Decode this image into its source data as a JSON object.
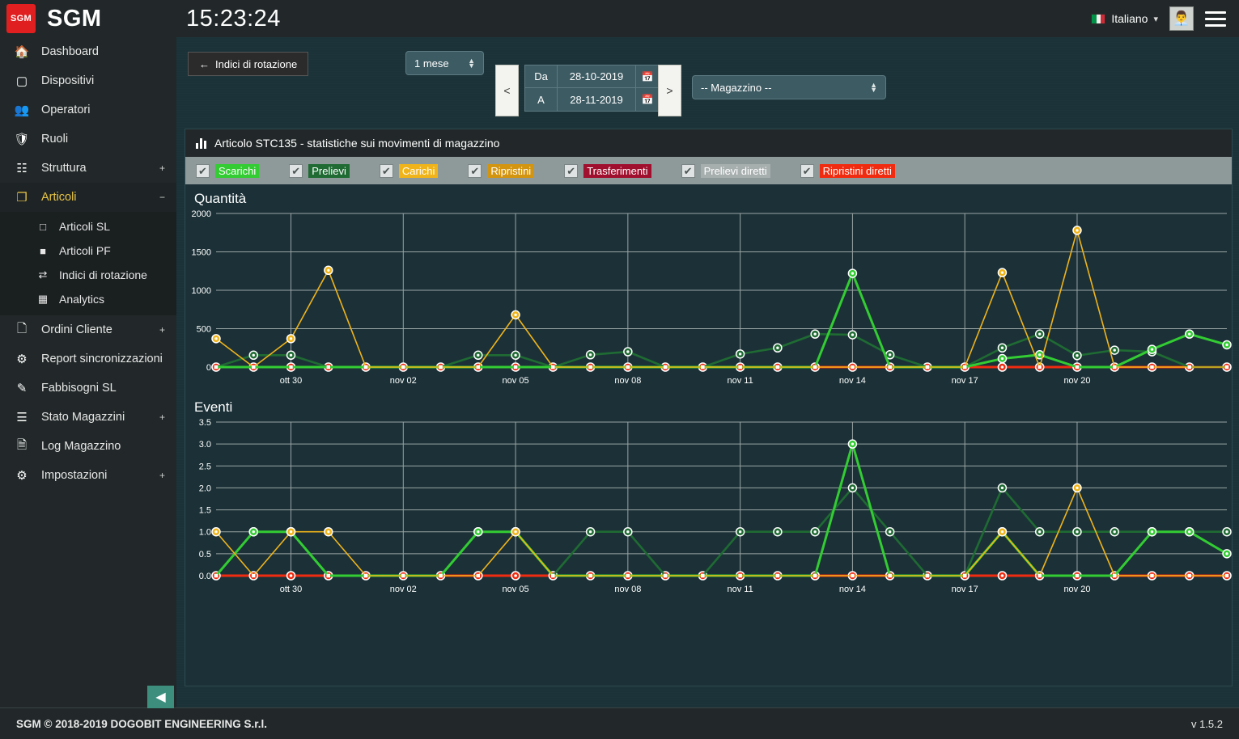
{
  "topbar": {
    "logo_text": "SGM",
    "brand": "SGM",
    "clock": "15:23:24",
    "language": "Italiano",
    "caret_icon": "chevron-down-icon",
    "avatar_icon": "user-avatar",
    "menu_icon": "hamburger-icon"
  },
  "sidebar": {
    "items": [
      {
        "label": "Dashboard",
        "icon": "home-icon",
        "expand": null,
        "active": false
      },
      {
        "label": "Dispositivi",
        "icon": "tablet-icon",
        "expand": null,
        "active": false
      },
      {
        "label": "Operatori",
        "icon": "users-icon",
        "expand": null,
        "active": false
      },
      {
        "label": "Ruoli",
        "icon": "shield-icon",
        "expand": null,
        "active": false
      },
      {
        "label": "Struttura",
        "icon": "sitemap-icon",
        "expand": "+",
        "active": false
      },
      {
        "label": "Articoli",
        "icon": "copy-icon",
        "expand": "−",
        "active": true
      }
    ],
    "sub_items": [
      {
        "label": "Articoli SL",
        "icon": "square-outline-icon"
      },
      {
        "label": "Articoli PF",
        "icon": "square-filled-icon"
      },
      {
        "label": "Indici di rotazione",
        "icon": "exchange-icon"
      },
      {
        "label": "Analytics",
        "icon": "table-icon"
      }
    ],
    "items_after": [
      {
        "label": "Ordini Cliente",
        "icon": "files-icon",
        "expand": "+"
      },
      {
        "label": "Report sincronizzazioni",
        "icon": "cogs-icon",
        "expand": null
      },
      {
        "label": "Fabbisogni SL",
        "icon": "edit-icon",
        "expand": null
      },
      {
        "label": "Stato Magazzini",
        "icon": "server-icon",
        "expand": "+"
      },
      {
        "label": "Log Magazzino",
        "icon": "file-text-icon",
        "expand": null
      },
      {
        "label": "Impostazioni",
        "icon": "gear-icon",
        "expand": "+"
      }
    ],
    "collapse_icon": "collapse-left-icon"
  },
  "toolbar": {
    "back_label": "Indici di rotazione",
    "back_icon": "arrow-left-icon",
    "period_value": "1 mese",
    "prev_label": "<",
    "next_label": ">",
    "from_label": "Da",
    "from_value": "28-10-2019",
    "to_label": "A",
    "to_value": "28-11-2019",
    "calendar_icon": "calendar-icon",
    "warehouse_value": "-- Magazzino --"
  },
  "panel": {
    "title": "Articolo STC135 - statistiche sui movimenti di magazzino",
    "title_icon": "bar-chart-icon",
    "legend": [
      {
        "label": "Scarichi",
        "bg": "#33cc33",
        "fg": "#ffffff",
        "checked": true
      },
      {
        "label": "Prelievi",
        "bg": "#1f6b33",
        "fg": "#ffffff",
        "checked": true
      },
      {
        "label": "Carichi",
        "bg": "#f0b41a",
        "fg": "#ffffff",
        "checked": true
      },
      {
        "label": "Ripristini",
        "bg": "#d39410",
        "fg": "#ffffff",
        "checked": true
      },
      {
        "label": "Trasferimenti",
        "bg": "#a00f2e",
        "fg": "#ffffff",
        "checked": true
      },
      {
        "label": "Prelievi diretti",
        "bg": "#a7aeae",
        "fg": "#ffffff",
        "checked": true
      },
      {
        "label": "Ripristini diretti",
        "bg": "#f02b10",
        "fg": "#ffffff",
        "checked": true
      }
    ]
  },
  "chart_data": [
    {
      "type": "line",
      "title": "Quantità",
      "xlabel": "",
      "ylabel": "",
      "ylim": [
        0,
        2000
      ],
      "yticks": [
        0,
        500,
        1000,
        1500,
        2000
      ],
      "ytick_labels": [
        "0",
        "500",
        "1000",
        "1500",
        "2000"
      ],
      "grid": true,
      "legend_position": "top",
      "x": [
        "ott 28",
        "ott 29",
        "ott 30",
        "ott 31",
        "nov 01",
        "nov 02",
        "nov 03",
        "nov 04",
        "nov 05",
        "nov 06",
        "nov 07",
        "nov 08",
        "nov 09",
        "nov 10",
        "nov 11",
        "nov 12",
        "nov 13",
        "nov 14",
        "nov 15",
        "nov 16",
        "nov 17",
        "nov 18",
        "nov 19",
        "nov 20",
        "nov 21",
        "nov 22",
        "nov 23",
        "nov 24"
      ],
      "xtick_labels": [
        "ott 30",
        "nov 02",
        "nov 05",
        "nov 08",
        "nov 11",
        "nov 14",
        "nov 17",
        "nov 20"
      ],
      "xtick_indices": [
        2,
        5,
        8,
        11,
        14,
        17,
        20,
        23
      ],
      "series": [
        {
          "name": "Scarichi",
          "color": "#33cc33",
          "values": [
            0,
            0,
            0,
            0,
            0,
            0,
            0,
            0,
            0,
            0,
            0,
            0,
            0,
            0,
            0,
            0,
            0,
            1220,
            0,
            0,
            0,
            110,
            160,
            0,
            0,
            230,
            430,
            290
          ]
        },
        {
          "name": "Prelievi",
          "color": "#1f6b33",
          "values": [
            0,
            155,
            155,
            0,
            0,
            0,
            0,
            155,
            155,
            0,
            160,
            200,
            0,
            0,
            170,
            250,
            430,
            420,
            160,
            0,
            0,
            250,
            430,
            150,
            220,
            200,
            0,
            0
          ]
        },
        {
          "name": "Carichi",
          "color": "#f0b41a",
          "values": [
            370,
            0,
            370,
            1260,
            0,
            0,
            0,
            0,
            680,
            0,
            0,
            0,
            0,
            0,
            0,
            0,
            0,
            0,
            0,
            0,
            0,
            1230,
            0,
            1780,
            0,
            0,
            0,
            0
          ]
        },
        {
          "name": "Ripristini",
          "color": "#d39410",
          "values": [
            0,
            0,
            0,
            0,
            0,
            0,
            0,
            0,
            0,
            0,
            0,
            0,
            0,
            0,
            0,
            0,
            0,
            0,
            0,
            0,
            0,
            0,
            0,
            0,
            0,
            0,
            0,
            0
          ]
        },
        {
          "name": "Trasferimenti",
          "color": "#a00f2e",
          "values": [
            0,
            0,
            0,
            0,
            0,
            0,
            0,
            0,
            0,
            0,
            0,
            0,
            0,
            0,
            0,
            0,
            0,
            0,
            0,
            0,
            0,
            0,
            0,
            0,
            0,
            0,
            0,
            0
          ]
        },
        {
          "name": "Prelievi diretti",
          "color": "#a7aeae",
          "values": [
            0,
            0,
            0,
            0,
            0,
            0,
            0,
            0,
            0,
            0,
            0,
            0,
            0,
            0,
            0,
            0,
            0,
            0,
            0,
            0,
            0,
            0,
            0,
            0,
            0,
            0,
            0,
            0
          ]
        },
        {
          "name": "Ripristini diretti",
          "color": "#f02b10",
          "values": [
            0,
            0,
            0,
            0,
            0,
            0,
            0,
            0,
            0,
            0,
            0,
            0,
            0,
            0,
            0,
            0,
            0,
            0,
            0,
            0,
            0,
            0,
            0,
            0,
            0,
            0,
            0,
            0
          ]
        }
      ]
    },
    {
      "type": "line",
      "title": "Eventi",
      "xlabel": "",
      "ylabel": "",
      "ylim": [
        0,
        3.5
      ],
      "yticks": [
        0.0,
        0.5,
        1.0,
        1.5,
        2.0,
        2.5,
        3.0,
        3.5
      ],
      "ytick_labels": [
        "0.0",
        "0.5",
        "1.0",
        "1.5",
        "2.0",
        "2.5",
        "3.0",
        "3.5"
      ],
      "grid": true,
      "legend_position": "top",
      "x": [
        "ott 28",
        "ott 29",
        "ott 30",
        "ott 31",
        "nov 01",
        "nov 02",
        "nov 03",
        "nov 04",
        "nov 05",
        "nov 06",
        "nov 07",
        "nov 08",
        "nov 09",
        "nov 10",
        "nov 11",
        "nov 12",
        "nov 13",
        "nov 14",
        "nov 15",
        "nov 16",
        "nov 17",
        "nov 18",
        "nov 19",
        "nov 20",
        "nov 21",
        "nov 22",
        "nov 23",
        "nov 24"
      ],
      "xtick_labels": [
        "ott 30",
        "nov 02",
        "nov 05",
        "nov 08",
        "nov 11",
        "nov 14",
        "nov 17",
        "nov 20"
      ],
      "xtick_indices": [
        2,
        5,
        8,
        11,
        14,
        17,
        20,
        23
      ],
      "series": [
        {
          "name": "Scarichi",
          "color": "#33cc33",
          "values": [
            0,
            1,
            1,
            0,
            0,
            0,
            0,
            1,
            1,
            0,
            0,
            0,
            0,
            0,
            0,
            0,
            0,
            3,
            0,
            0,
            0,
            1,
            0,
            0,
            0,
            1,
            1,
            0.5
          ]
        },
        {
          "name": "Prelievi",
          "color": "#1f6b33",
          "values": [
            0,
            1,
            1,
            0,
            0,
            0,
            0,
            1,
            1,
            0,
            1,
            1,
            0,
            0,
            1,
            1,
            1,
            2,
            1,
            0,
            0,
            2,
            1,
            1,
            1,
            1,
            1,
            1
          ]
        },
        {
          "name": "Carichi",
          "color": "#f0b41a",
          "values": [
            1,
            0,
            1,
            1,
            0,
            0,
            0,
            0,
            1,
            0,
            0,
            0,
            0,
            0,
            0,
            0,
            0,
            0,
            0,
            0,
            0,
            1,
            0,
            2,
            0,
            0,
            0,
            0
          ]
        },
        {
          "name": "Ripristini",
          "color": "#d39410",
          "values": [
            0,
            0,
            0,
            0,
            0,
            0,
            0,
            0,
            0,
            0,
            0,
            0,
            0,
            0,
            0,
            0,
            0,
            0,
            0,
            0,
            0,
            0,
            0,
            0,
            0,
            0,
            0,
            0
          ]
        },
        {
          "name": "Trasferimenti",
          "color": "#a00f2e",
          "values": [
            0,
            0,
            0,
            0,
            0,
            0,
            0,
            0,
            0,
            0,
            0,
            0,
            0,
            0,
            0,
            0,
            0,
            0,
            0,
            0,
            0,
            0,
            0,
            0,
            0,
            0,
            0,
            0
          ]
        },
        {
          "name": "Prelievi diretti",
          "color": "#a7aeae",
          "values": [
            0,
            0,
            0,
            0,
            0,
            0,
            0,
            0,
            0,
            0,
            0,
            0,
            0,
            0,
            0,
            0,
            0,
            0,
            0,
            0,
            0,
            0,
            0,
            0,
            0,
            0,
            0,
            0
          ]
        },
        {
          "name": "Ripristini diretti",
          "color": "#f02b10",
          "values": [
            0,
            0,
            0,
            0,
            0,
            0,
            0,
            0,
            0,
            0,
            0,
            0,
            0,
            0,
            0,
            0,
            0,
            0,
            0,
            0,
            0,
            0,
            0,
            0,
            0,
            0,
            0,
            0
          ]
        }
      ]
    }
  ],
  "footer": {
    "copyright": "SGM © 2018-2019 DOGOBIT ENGINEERING S.r.l.",
    "version": "v 1.5.2"
  }
}
